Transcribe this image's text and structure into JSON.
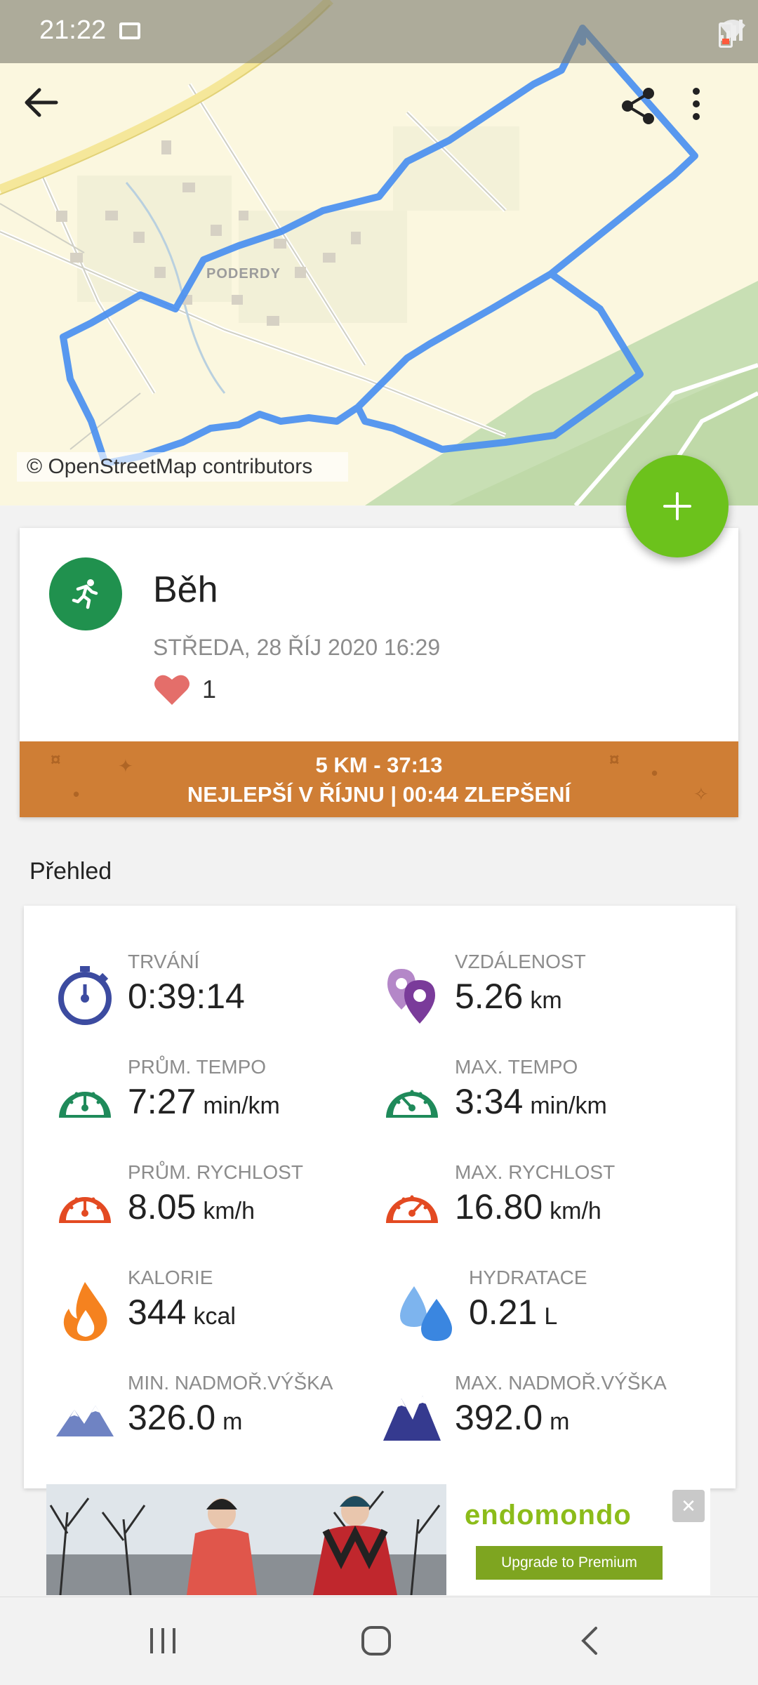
{
  "status_bar": {
    "time": "21:22"
  },
  "map": {
    "credit": "© OpenStreetMap contributors",
    "place_label": "PODERDY",
    "route_color": "#4a8ff0"
  },
  "toolbar": {
    "back_icon": "arrow-left-icon",
    "share_icon": "share-icon",
    "more_icon": "more-vertical-icon"
  },
  "fab": {
    "label": "+",
    "color": "#6cc21c"
  },
  "activity": {
    "title": "Běh",
    "date": "STŘEDA, 28 ŘÍJ 2020 16:29",
    "likes": "1",
    "achievement_line1": "5 KM  -  37:13",
    "achievement_line2": "NEJLEPŠÍ V ŘÍJNU  |  00:44 ZLEPŠENÍ",
    "banner_color": "#cf7e35"
  },
  "overview": {
    "title": "Přehled",
    "stats": [
      {
        "label": "TRVÁNÍ",
        "value": "0:39:14",
        "unit": ""
      },
      {
        "label": "VZDÁLENOST",
        "value": "5.26",
        "unit": "km"
      },
      {
        "label": "PRŮM. TEMPO",
        "value": "7:27",
        "unit": "min/km"
      },
      {
        "label": "MAX. TEMPO",
        "value": "3:34",
        "unit": "min/km"
      },
      {
        "label": "PRŮM. RYCHLOST",
        "value": "8.05",
        "unit": "km/h"
      },
      {
        "label": "MAX. RYCHLOST",
        "value": "16.80",
        "unit": "km/h"
      },
      {
        "label": "KALORIE",
        "value": "344",
        "unit": "kcal"
      },
      {
        "label": "HYDRATACE",
        "value": "0.21",
        "unit": "L"
      },
      {
        "label": "MIN. NADMOŘ.VÝŠKA",
        "value": "326.0",
        "unit": "m"
      },
      {
        "label": "MAX. NADMOŘ.VÝŠKA",
        "value": "392.0",
        "unit": "m"
      }
    ]
  },
  "ad": {
    "brand": "endomondo",
    "cta": "Upgrade to Premium"
  }
}
